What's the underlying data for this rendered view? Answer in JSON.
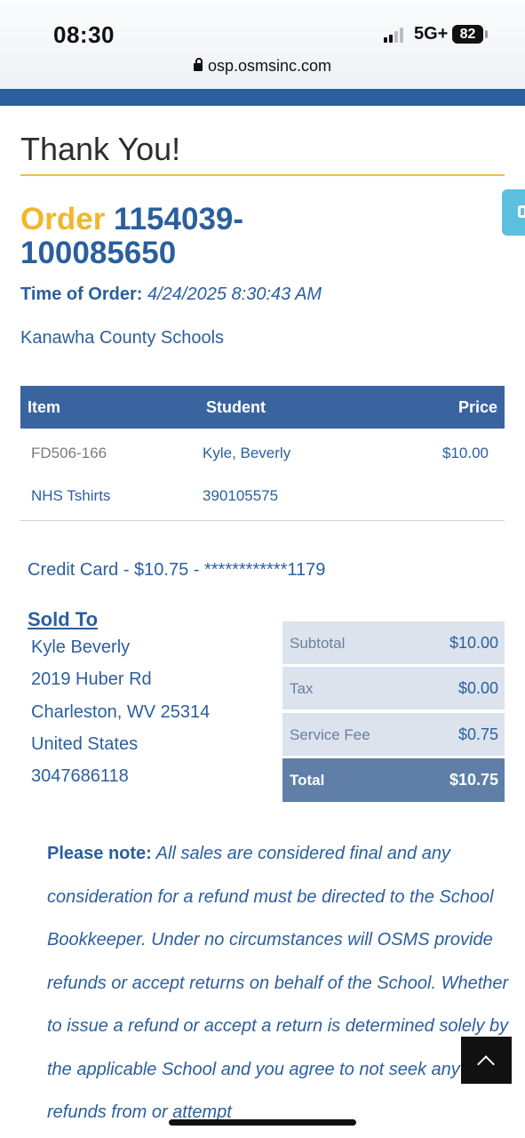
{
  "status_bar": {
    "time": "08:30",
    "network": "5G+",
    "battery": "82",
    "url": "osp.osmsinc.com"
  },
  "page": {
    "heading": "Thank You!",
    "order_label": "Order",
    "order_number": "1154039-100085650",
    "time_of_order_label": "Time of Order:",
    "time_of_order_value": "4/24/2025 8:30:43 AM",
    "school": "Kanawha County Schools"
  },
  "items_table": {
    "headers": {
      "item": "Item",
      "student": "Student",
      "price": "Price"
    },
    "rows": [
      {
        "item": "FD506-166",
        "student": "Kyle, Beverly",
        "price": "$10.00"
      },
      {
        "item": "NHS Tshirts",
        "student": "390105575",
        "price": ""
      }
    ]
  },
  "payment_line": "Credit Card - $10.75 - ************1179",
  "sold_to": {
    "title": "Sold To",
    "lines": [
      "Kyle Beverly",
      "2019 Huber Rd",
      "Charleston, WV 25314",
      "United States",
      "3047686118"
    ]
  },
  "summary": [
    {
      "label": "Subtotal",
      "value": "$10.00"
    },
    {
      "label": "Tax",
      "value": "$0.00"
    },
    {
      "label": "Service Fee",
      "value": "$0.75"
    },
    {
      "label": "Total",
      "value": "$10.75"
    }
  ],
  "note": {
    "label": "Please note:",
    "text": "All sales are considered final and any consideration for a refund must be directed to the School Bookkeeper. Under no circumstances will OSMS provide refunds or accept returns on behalf of the School. Whether to issue a refund or accept a return is determined solely by the applicable School and you agree to not seek any refunds from or attempt"
  },
  "colors": {
    "brand_blue": "#2b5f9e",
    "accent_gold": "#f2b62c",
    "table_header": "#3a64a0",
    "summary_bg": "#dce3ed",
    "total_bg": "#5f7fa8",
    "side_tab": "#5bc0de"
  },
  "icons": {
    "lock": "lock-icon",
    "signal": "cellular-signal-icon",
    "battery": "battery-icon",
    "side_tab": "feedback-tab-icon",
    "back_to_top": "chevron-up-icon"
  }
}
